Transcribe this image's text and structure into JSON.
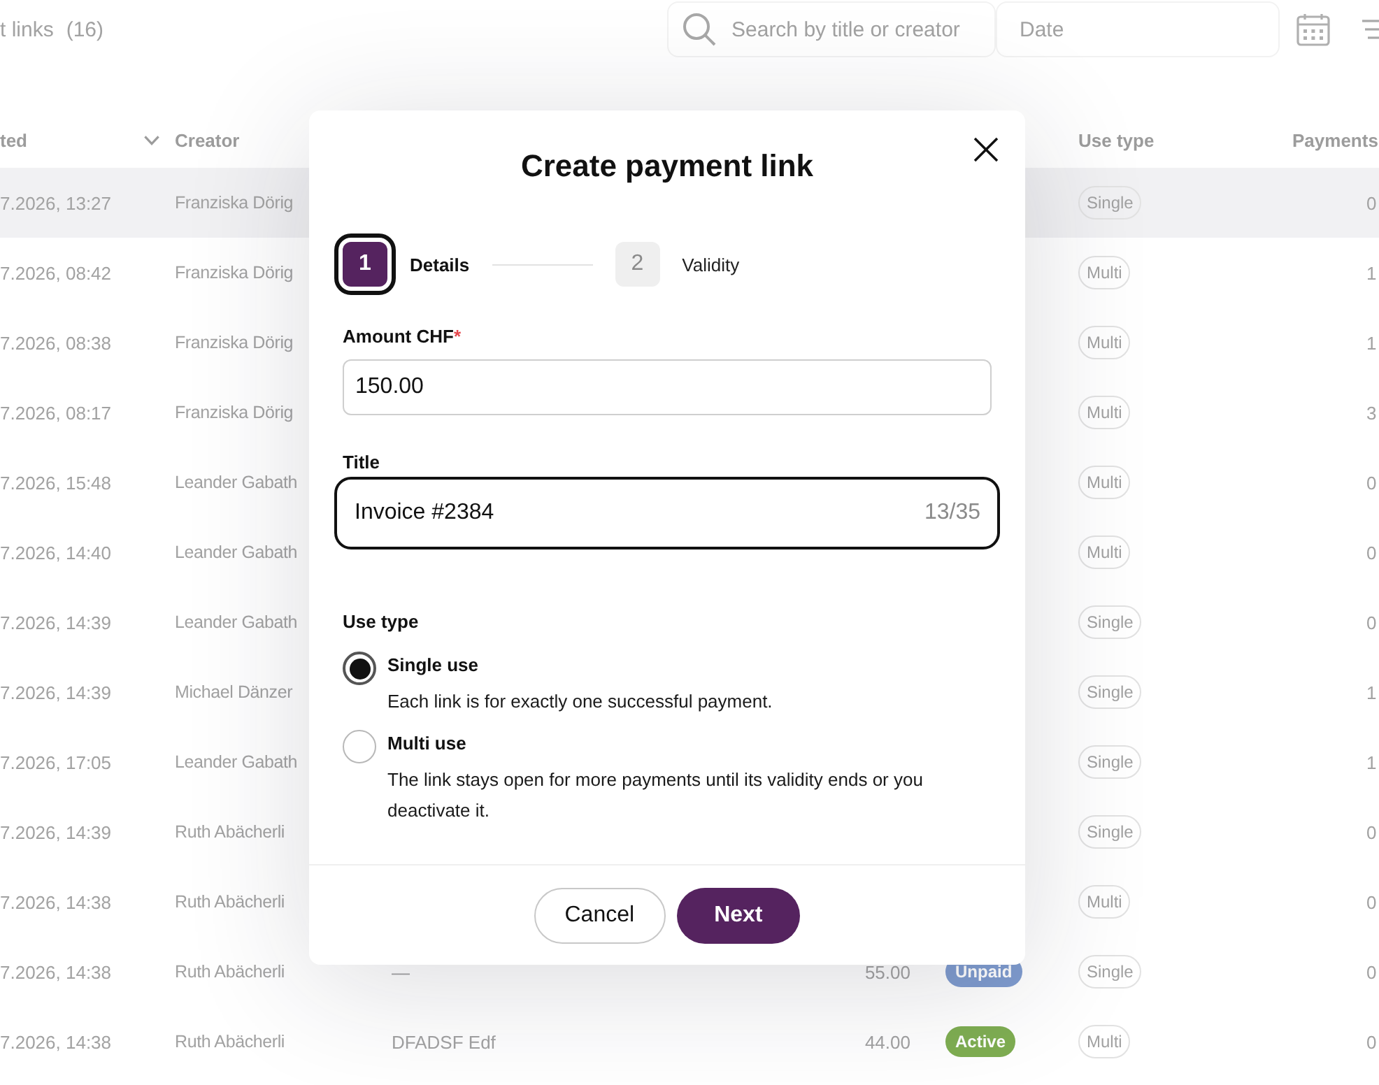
{
  "page": {
    "title": "t links",
    "count": "(16)",
    "search": {
      "placeholder": "Search by title or creator"
    },
    "date_filter": {
      "placeholder": "Date"
    }
  },
  "table": {
    "columns": [
      {
        "label": "ted",
        "sorted": true
      },
      {
        "label": "Creator",
        "sorted": false
      },
      {
        "label": "Use type",
        "sorted": false
      },
      {
        "label": "Payments",
        "sorted": false
      }
    ],
    "rows": [
      {
        "selected": true,
        "created": "7.2026, 13:27",
        "creator": "Franziska Dörig",
        "use_type": "Single",
        "payments": "0"
      },
      {
        "selected": false,
        "created": "7.2026, 08:42",
        "creator": "Franziska Dörig",
        "use_type": "Multi",
        "payments": "1"
      },
      {
        "selected": false,
        "created": "7.2026, 08:38",
        "creator": "Franziska Dörig",
        "use_type": "Multi",
        "payments": "1"
      },
      {
        "selected": false,
        "created": "7.2026, 08:17",
        "creator": "Franziska Dörig",
        "use_type": "Multi",
        "payments": "3"
      },
      {
        "selected": false,
        "created": "7.2026, 15:48",
        "creator": "Leander Gabath",
        "use_type": "Multi",
        "payments": "0"
      },
      {
        "selected": false,
        "created": "7.2026, 14:40",
        "creator": "Leander Gabath",
        "use_type": "Multi",
        "payments": "0"
      },
      {
        "selected": false,
        "created": "7.2026, 14:39",
        "creator": "Leander Gabath",
        "use_type": "Single",
        "payments": "0"
      },
      {
        "selected": false,
        "created": "7.2026, 14:39",
        "creator": "Michael Dänzer",
        "use_type": "Single",
        "payments": "1"
      },
      {
        "selected": false,
        "created": "7.2026, 17:05",
        "creator": "Leander Gabath",
        "use_type": "Single",
        "payments": "1"
      },
      {
        "selected": false,
        "created": "7.2026, 14:39",
        "creator": "Ruth Abächerli",
        "use_type": "Single",
        "payments": "0"
      },
      {
        "selected": false,
        "created": "7.2026, 14:38",
        "creator": "Ruth Abächerli",
        "use_type": "Multi",
        "payments": "0"
      },
      {
        "selected": false,
        "created": "7.2026, 14:38",
        "creator": "Ruth Abächerli",
        "title": "—",
        "amount": "55.00",
        "status": {
          "label": "Unpaid",
          "color": "#7f9ccf"
        },
        "use_type": "Single",
        "payments": "0"
      },
      {
        "selected": false,
        "created": "7.2026, 14:38",
        "creator": "Ruth Abächerli",
        "title": "DFADSF Edf",
        "amount": "44.00",
        "status": {
          "label": "Active",
          "color": "#7fae52"
        },
        "use_type": "Multi",
        "payments": "0"
      }
    ]
  },
  "dialog": {
    "title": "Create payment link",
    "steps": [
      {
        "number": "1",
        "label": "Details",
        "selected": true
      },
      {
        "number": "2",
        "label": "Validity",
        "selected": false
      }
    ],
    "amount": {
      "label": "Amount CHF",
      "required_mark": "*",
      "value": "150.00"
    },
    "title_field": {
      "label": "Title",
      "value": "Invoice #2384",
      "counter": "13/35",
      "focused": true
    },
    "use_type": {
      "label": "Use type",
      "options": [
        {
          "label": "Single use",
          "description": "Each link is for exactly one successful payment.",
          "selected": true
        },
        {
          "label": "Multi use",
          "description": "The link stays open for more payments until its validity ends or you deactivate it.",
          "selected": false
        }
      ]
    },
    "buttons": [
      {
        "label": "Cancel",
        "kind": "secondary"
      },
      {
        "label": "Next",
        "kind": "primary"
      }
    ]
  }
}
